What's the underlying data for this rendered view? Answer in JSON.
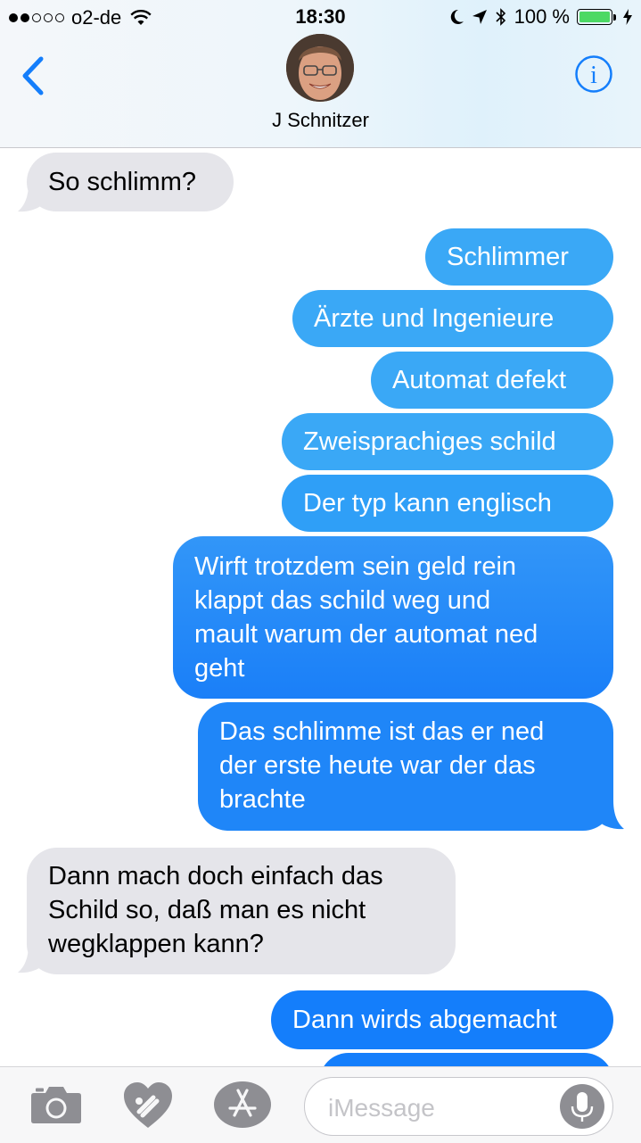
{
  "status_bar": {
    "signal_dots_filled": 2,
    "signal_dots_total": 5,
    "carrier": "o2-de",
    "time": "18:30",
    "battery": "100 %"
  },
  "header": {
    "contact_name": "J Schnitzer",
    "info_glyph": "i"
  },
  "messages": [
    {
      "side": "received",
      "text": "So schlimm?"
    },
    {
      "side": "sent",
      "text": "Schlimmer"
    },
    {
      "side": "sent",
      "text": "Ärzte und Ingenieure"
    },
    {
      "side": "sent",
      "text": "Automat defekt"
    },
    {
      "side": "sent",
      "text": "Zweisprachiges schild"
    },
    {
      "side": "sent",
      "text": "Der typ kann englisch"
    },
    {
      "side": "sent",
      "lines": [
        "Wirft trotzdem sein geld rein",
        "klappt das schild weg und",
        "mault warum der automat ned",
        "geht"
      ]
    },
    {
      "side": "sent",
      "lines": [
        "Das schlimme ist das er ned",
        "der erste heute war der das",
        "brachte"
      ]
    },
    {
      "side": "received",
      "lines": [
        "Dann mach doch einfach das",
        "Schild so, daß man es nicht",
        "wegklappen kann?"
      ]
    },
    {
      "side": "sent",
      "text": "Dann wirds abgemacht"
    }
  ],
  "input": {
    "placeholder": "iMessage"
  },
  "icons": {
    "back": "chevron-left-icon",
    "info": "info-icon",
    "camera": "camera-icon",
    "digital_touch": "heart-touch-icon",
    "app_store": "app-store-icon",
    "mic": "microphone-icon"
  },
  "colors": {
    "ios_blue": "#147efb",
    "sent_light": "#3aa8f6",
    "sent_deep": "#1a7ff8",
    "received": "#e5e5ea",
    "battery_green": "#4cd964"
  }
}
